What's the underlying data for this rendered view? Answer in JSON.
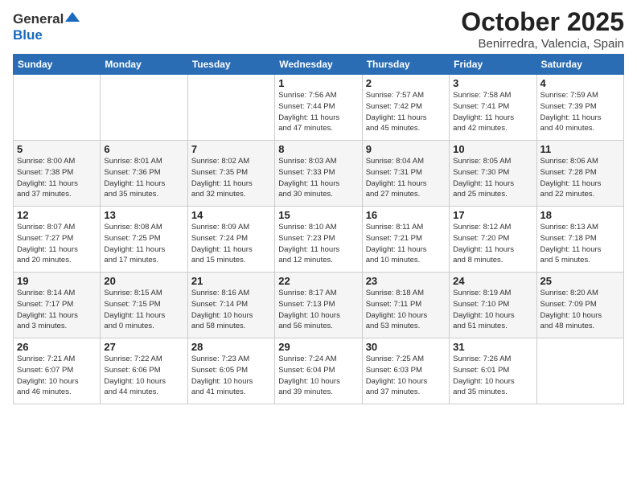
{
  "header": {
    "logo_general": "General",
    "logo_blue": "Blue",
    "month_title": "October 2025",
    "location": "Benirredra, Valencia, Spain"
  },
  "days_of_week": [
    "Sunday",
    "Monday",
    "Tuesday",
    "Wednesday",
    "Thursday",
    "Friday",
    "Saturday"
  ],
  "weeks": [
    [
      {
        "day": "",
        "info": ""
      },
      {
        "day": "",
        "info": ""
      },
      {
        "day": "",
        "info": ""
      },
      {
        "day": "1",
        "info": "Sunrise: 7:56 AM\nSunset: 7:44 PM\nDaylight: 11 hours\nand 47 minutes."
      },
      {
        "day": "2",
        "info": "Sunrise: 7:57 AM\nSunset: 7:42 PM\nDaylight: 11 hours\nand 45 minutes."
      },
      {
        "day": "3",
        "info": "Sunrise: 7:58 AM\nSunset: 7:41 PM\nDaylight: 11 hours\nand 42 minutes."
      },
      {
        "day": "4",
        "info": "Sunrise: 7:59 AM\nSunset: 7:39 PM\nDaylight: 11 hours\nand 40 minutes."
      }
    ],
    [
      {
        "day": "5",
        "info": "Sunrise: 8:00 AM\nSunset: 7:38 PM\nDaylight: 11 hours\nand 37 minutes."
      },
      {
        "day": "6",
        "info": "Sunrise: 8:01 AM\nSunset: 7:36 PM\nDaylight: 11 hours\nand 35 minutes."
      },
      {
        "day": "7",
        "info": "Sunrise: 8:02 AM\nSunset: 7:35 PM\nDaylight: 11 hours\nand 32 minutes."
      },
      {
        "day": "8",
        "info": "Sunrise: 8:03 AM\nSunset: 7:33 PM\nDaylight: 11 hours\nand 30 minutes."
      },
      {
        "day": "9",
        "info": "Sunrise: 8:04 AM\nSunset: 7:31 PM\nDaylight: 11 hours\nand 27 minutes."
      },
      {
        "day": "10",
        "info": "Sunrise: 8:05 AM\nSunset: 7:30 PM\nDaylight: 11 hours\nand 25 minutes."
      },
      {
        "day": "11",
        "info": "Sunrise: 8:06 AM\nSunset: 7:28 PM\nDaylight: 11 hours\nand 22 minutes."
      }
    ],
    [
      {
        "day": "12",
        "info": "Sunrise: 8:07 AM\nSunset: 7:27 PM\nDaylight: 11 hours\nand 20 minutes."
      },
      {
        "day": "13",
        "info": "Sunrise: 8:08 AM\nSunset: 7:25 PM\nDaylight: 11 hours\nand 17 minutes."
      },
      {
        "day": "14",
        "info": "Sunrise: 8:09 AM\nSunset: 7:24 PM\nDaylight: 11 hours\nand 15 minutes."
      },
      {
        "day": "15",
        "info": "Sunrise: 8:10 AM\nSunset: 7:23 PM\nDaylight: 11 hours\nand 12 minutes."
      },
      {
        "day": "16",
        "info": "Sunrise: 8:11 AM\nSunset: 7:21 PM\nDaylight: 11 hours\nand 10 minutes."
      },
      {
        "day": "17",
        "info": "Sunrise: 8:12 AM\nSunset: 7:20 PM\nDaylight: 11 hours\nand 8 minutes."
      },
      {
        "day": "18",
        "info": "Sunrise: 8:13 AM\nSunset: 7:18 PM\nDaylight: 11 hours\nand 5 minutes."
      }
    ],
    [
      {
        "day": "19",
        "info": "Sunrise: 8:14 AM\nSunset: 7:17 PM\nDaylight: 11 hours\nand 3 minutes."
      },
      {
        "day": "20",
        "info": "Sunrise: 8:15 AM\nSunset: 7:15 PM\nDaylight: 11 hours\nand 0 minutes."
      },
      {
        "day": "21",
        "info": "Sunrise: 8:16 AM\nSunset: 7:14 PM\nDaylight: 10 hours\nand 58 minutes."
      },
      {
        "day": "22",
        "info": "Sunrise: 8:17 AM\nSunset: 7:13 PM\nDaylight: 10 hours\nand 56 minutes."
      },
      {
        "day": "23",
        "info": "Sunrise: 8:18 AM\nSunset: 7:11 PM\nDaylight: 10 hours\nand 53 minutes."
      },
      {
        "day": "24",
        "info": "Sunrise: 8:19 AM\nSunset: 7:10 PM\nDaylight: 10 hours\nand 51 minutes."
      },
      {
        "day": "25",
        "info": "Sunrise: 8:20 AM\nSunset: 7:09 PM\nDaylight: 10 hours\nand 48 minutes."
      }
    ],
    [
      {
        "day": "26",
        "info": "Sunrise: 7:21 AM\nSunset: 6:07 PM\nDaylight: 10 hours\nand 46 minutes."
      },
      {
        "day": "27",
        "info": "Sunrise: 7:22 AM\nSunset: 6:06 PM\nDaylight: 10 hours\nand 44 minutes."
      },
      {
        "day": "28",
        "info": "Sunrise: 7:23 AM\nSunset: 6:05 PM\nDaylight: 10 hours\nand 41 minutes."
      },
      {
        "day": "29",
        "info": "Sunrise: 7:24 AM\nSunset: 6:04 PM\nDaylight: 10 hours\nand 39 minutes."
      },
      {
        "day": "30",
        "info": "Sunrise: 7:25 AM\nSunset: 6:03 PM\nDaylight: 10 hours\nand 37 minutes."
      },
      {
        "day": "31",
        "info": "Sunrise: 7:26 AM\nSunset: 6:01 PM\nDaylight: 10 hours\nand 35 minutes."
      },
      {
        "day": "",
        "info": ""
      }
    ]
  ]
}
